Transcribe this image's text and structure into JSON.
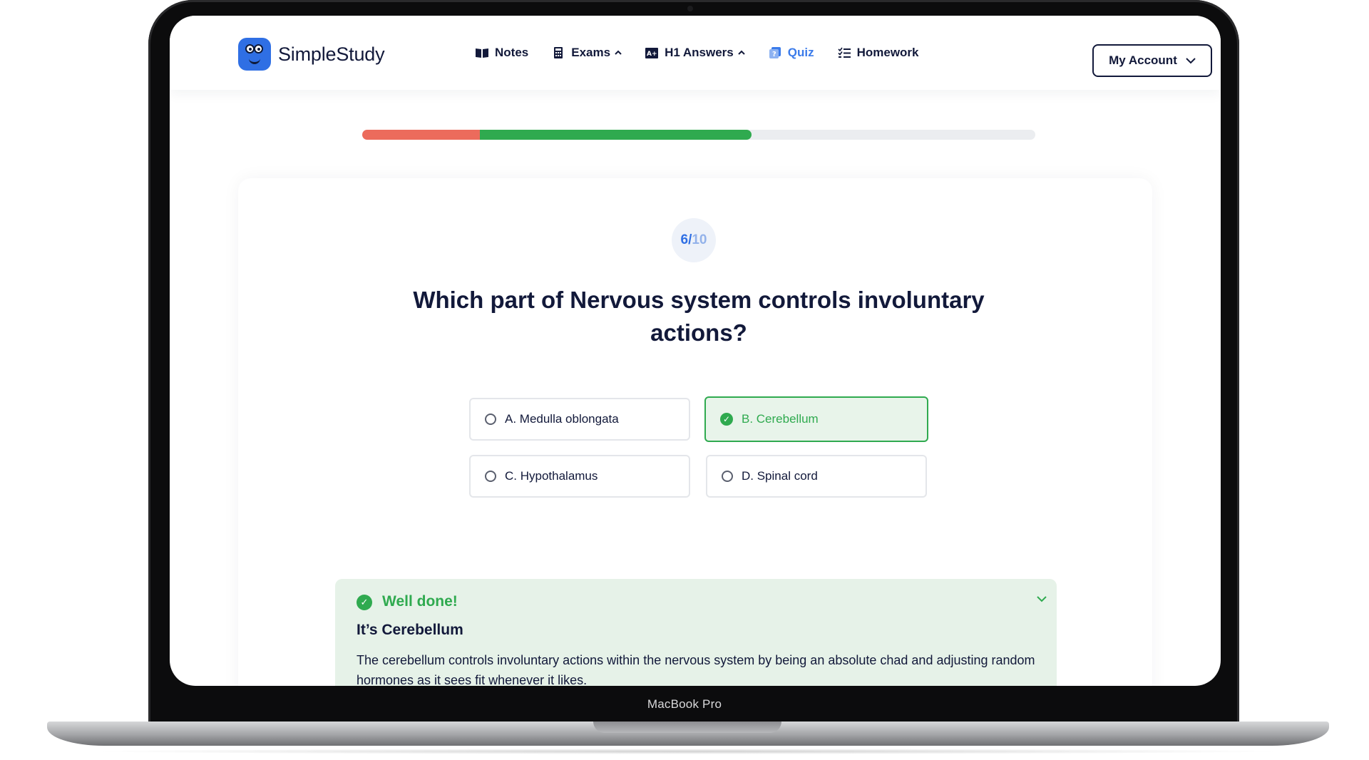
{
  "device": {
    "caption": "MacBook Pro"
  },
  "header": {
    "brand": "SimpleStudy",
    "nav": [
      {
        "label": "Notes",
        "icon": "book-icon"
      },
      {
        "label": "Exams",
        "icon": "calculator-icon",
        "chevron": "up"
      },
      {
        "label": "H1 Answers",
        "icon": "grade-icon",
        "chevron": "up"
      },
      {
        "label": "Quiz",
        "icon": "quiz-icon",
        "active": true
      },
      {
        "label": "Homework",
        "icon": "checklist-icon"
      }
    ],
    "account_label": "My Account"
  },
  "progress": {
    "wrong_fraction": 0.175,
    "correct_fraction": 0.403,
    "wrong_color": "#ec6b5c",
    "correct_color": "#2faa4f"
  },
  "quiz": {
    "counter_current": "6",
    "counter_sep": "/",
    "counter_total": "10",
    "question": "Which part of Nervous system controls involuntary actions?",
    "options": [
      {
        "label": "A. Medulla oblongata",
        "selected": false
      },
      {
        "label": "B. Cerebellum",
        "selected": true
      },
      {
        "label": "C. Hypothalamus",
        "selected": false
      },
      {
        "label": "D. Spinal cord",
        "selected": false
      }
    ]
  },
  "feedback": {
    "title": "Well done!",
    "answer": "It’s Cerebellum",
    "explanation": "The cerebellum controls involuntary actions within the nervous system by being an absolute chad and adjusting random hormones as it sees fit whenever it likes."
  },
  "colors": {
    "accent": "#2f6fe4",
    "success": "#2faa4f",
    "text": "#12193a"
  }
}
